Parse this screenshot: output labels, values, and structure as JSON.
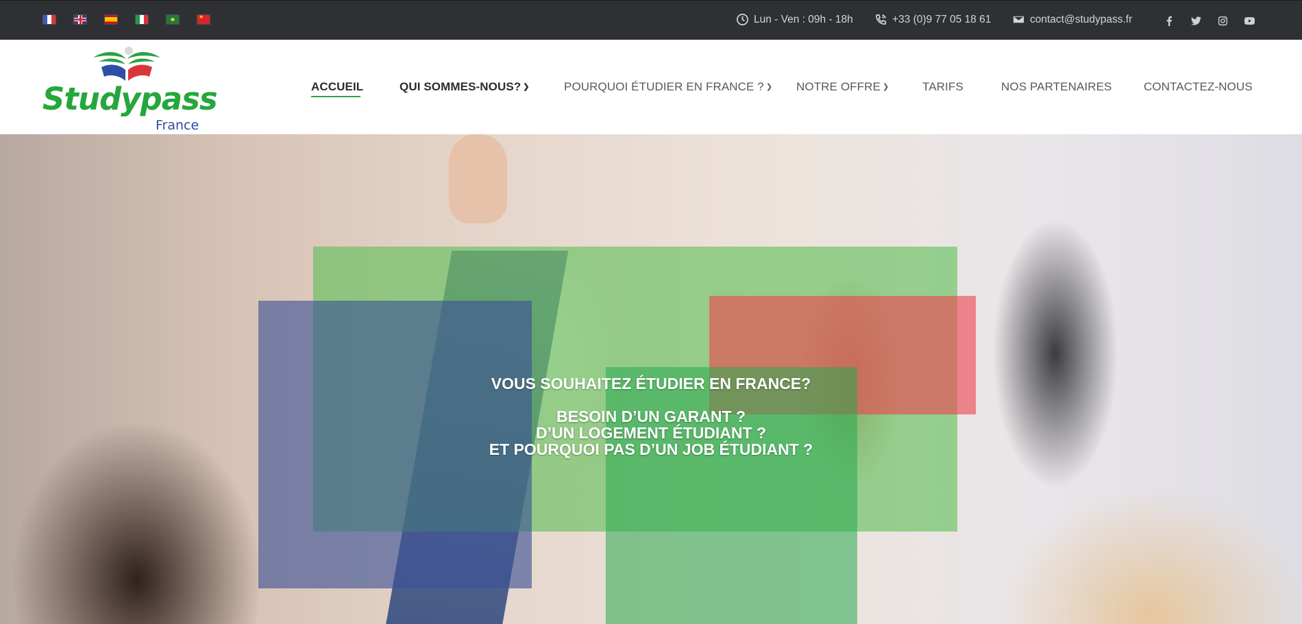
{
  "topbar": {
    "languages": [
      {
        "code": "fr",
        "icon": "flag-france-icon"
      },
      {
        "code": "en",
        "icon": "flag-uk-icon"
      },
      {
        "code": "es",
        "icon": "flag-spain-icon"
      },
      {
        "code": "it",
        "icon": "flag-italy-icon"
      },
      {
        "code": "ar",
        "icon": "flag-arabic-icon"
      },
      {
        "code": "zh",
        "icon": "flag-china-icon"
      }
    ],
    "hours": "Lun - Ven : 09h - 18h",
    "phone": "+33 (0)9 77 05 18 61",
    "email": "contact@studypass.fr",
    "socials": [
      "facebook-icon",
      "twitter-icon",
      "instagram-icon",
      "youtube-icon"
    ],
    "background": "#2f3034"
  },
  "header": {
    "logo": {
      "name": "Studypass",
      "sub": "France"
    },
    "nav": [
      {
        "label": "ACCUEIL",
        "active": true
      },
      {
        "label": "QUI SOMMES-NOUS?",
        "dropdown": true
      },
      {
        "label": "POURQUOI ÉTUDIER EN FRANCE ?",
        "dropdown": true
      },
      {
        "label": "NOTRE OFFRE",
        "dropdown": true
      },
      {
        "label": "TARIFS"
      },
      {
        "label": "NOS PARTENAIRES"
      },
      {
        "label": "CONTACTEZ-NOUS"
      }
    ],
    "accent": "#2aa245"
  },
  "hero": {
    "headline": "VOUS SOUHAITEZ ÉTUDIER EN FRANCE?",
    "lines": [
      "BESOIN D’UN GARANT ?",
      "D’UN LOGEMENT ÉTUDIANT ?",
      "ET POURQUOI PAS D’UN JOB ÉTUDIANT ?"
    ]
  }
}
